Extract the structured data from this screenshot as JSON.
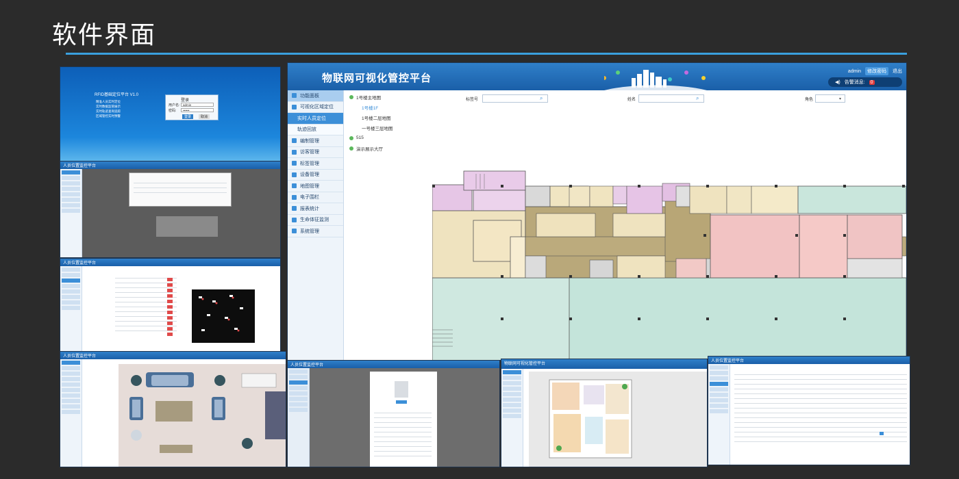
{
  "slide": {
    "title": "软件界面"
  },
  "main_app": {
    "title": "物联网可视化管控平台",
    "user": "admin",
    "change_password": "修改密码",
    "logout": "退出",
    "alarm_label": "告警消息:",
    "alarm_count": "0",
    "sidebar": [
      {
        "label": "功能面板",
        "active": true
      },
      {
        "label": "可视化区域定位"
      },
      {
        "label": "实时人员定位",
        "sub": true,
        "selected": true
      },
      {
        "label": "轨迹回放",
        "sub": true
      },
      {
        "label": "编制管理"
      },
      {
        "label": "访客管理"
      },
      {
        "label": "标签管理"
      },
      {
        "label": "设备管理"
      },
      {
        "label": "地图管理"
      },
      {
        "label": "电子围栏"
      },
      {
        "label": "报表统计"
      },
      {
        "label": "生命体征监测"
      },
      {
        "label": "系统管理"
      }
    ],
    "tree": [
      {
        "label": "1号楼主地图",
        "dot": true
      },
      {
        "label": "1号楼1F",
        "indent": true,
        "selected": true
      },
      {
        "label": "1号楼二层地图",
        "indent": true
      },
      {
        "label": "一号楼三层地图",
        "indent": true
      },
      {
        "label": "515",
        "dot": true
      },
      {
        "label": "演示展示大厅",
        "dot": true
      }
    ],
    "filters": {
      "tag_label": "标签号",
      "name_label": "姓名",
      "role_label": "角色"
    }
  },
  "login_shot": {
    "title": "RFID基础定位平台 V1.0",
    "features": [
      "精准人员实时定位",
      "实时数据监管展示",
      "实时轨迹查询追踪",
      "区域管控实时预警"
    ],
    "dialog_title": "登录",
    "user_label": "用户名:",
    "user_value": "admin",
    "pass_label": "密码:",
    "pass_value": "••••••",
    "login_button": "登录",
    "cancel_button": "取消"
  },
  "mini_titles": {
    "map1": "人员位置监控平台",
    "table": "人员位置监控平台",
    "room": "人员位置监控平台",
    "form": "人员位置监控平台",
    "plan": "物联网可视化管控平台",
    "list": "人员位置监控平台"
  },
  "colors": {
    "header": "#1a5fa8",
    "accent": "#3aa0de",
    "alarm": "#e03a3a"
  }
}
